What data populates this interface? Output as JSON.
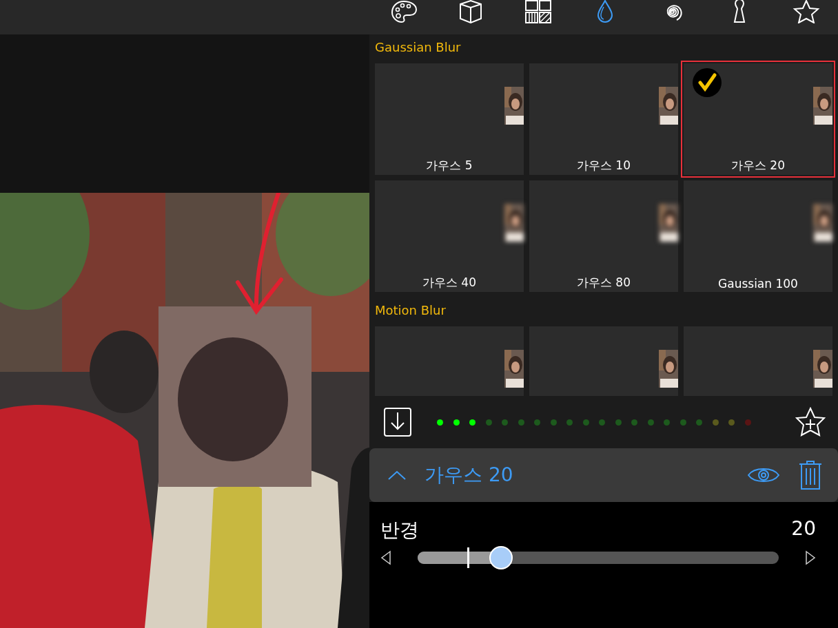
{
  "toolbar": [
    {
      "kind": "palette",
      "selected": false
    },
    {
      "kind": "cube",
      "selected": false
    },
    {
      "kind": "grid",
      "selected": false
    },
    {
      "kind": "drop",
      "selected": true
    },
    {
      "kind": "spiral",
      "selected": false
    },
    {
      "kind": "keyhole",
      "selected": false
    },
    {
      "kind": "star",
      "selected": false
    }
  ],
  "sections": [
    {
      "title": "Gaussian Blur",
      "tiles": [
        {
          "label": "가우스 5",
          "selected": false,
          "blurred": false
        },
        {
          "label": "가우스 10",
          "selected": false,
          "blurred": false
        },
        {
          "label": "가우스 20",
          "selected": true,
          "blurred": false
        },
        {
          "label": "가우스 40",
          "selected": false,
          "blurred": true
        },
        {
          "label": "가우스 80",
          "selected": false,
          "blurred": true
        },
        {
          "label": "Gaussian 100",
          "selected": false,
          "blurred": true
        }
      ]
    },
    {
      "title": "Motion Blur",
      "tiles": [
        {
          "selected": false,
          "blurred": false
        },
        {
          "selected": false,
          "blurred": false
        },
        {
          "selected": false,
          "blurred": false
        }
      ]
    }
  ],
  "meter": [
    {
      "color": "#00ff00"
    },
    {
      "color": "#00ff00"
    },
    {
      "color": "#00ff00"
    },
    {
      "color": "#1d5a1d"
    },
    {
      "color": "#1d5a1d"
    },
    {
      "color": "#1d5a1d"
    },
    {
      "color": "#1d5a1d"
    },
    {
      "color": "#1d5a1d"
    },
    {
      "color": "#1d5a1d"
    },
    {
      "color": "#1d5a1d"
    },
    {
      "color": "#1d5a1d"
    },
    {
      "color": "#1d5a1d"
    },
    {
      "color": "#1d5a1d"
    },
    {
      "color": "#1d5a1d"
    },
    {
      "color": "#1d5a1d"
    },
    {
      "color": "#1d5a1d"
    },
    {
      "color": "#1d5a1d"
    },
    {
      "color": "#5a5a1d"
    },
    {
      "color": "#5a5a1d"
    },
    {
      "color": "#5a1414"
    }
  ],
  "effect": {
    "title": "가우스 20",
    "expanded": true
  },
  "slider": {
    "label": "반경",
    "reading": "20",
    "level": 0.23
  }
}
